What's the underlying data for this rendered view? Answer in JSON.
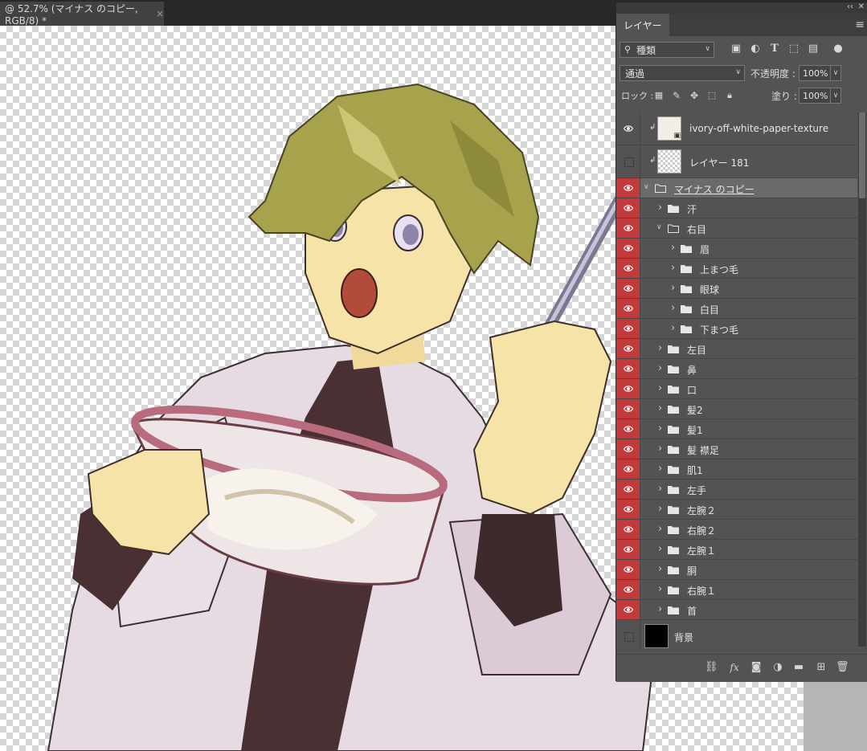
{
  "document_tab": {
    "title": "@ 52.7% (マイナス のコピー, RGB/8) *",
    "close": "×"
  },
  "panel": {
    "tab_label": "レイヤー",
    "collapse": "‹‹",
    "close": "✕",
    "menu": "≡",
    "filter": {
      "kind_label": "種類",
      "icons": [
        "image-filter-icon",
        "adjustment-filter-icon",
        "type-filter-icon",
        "shape-filter-icon",
        "smart-object-filter-icon",
        "filter-toggle-icon"
      ]
    },
    "blend_mode": "通過",
    "opacity_label": "不透明度 :",
    "opacity_value": "100%",
    "lock_label": "ロック :",
    "fill_label": "塗り :",
    "fill_value": "100%",
    "footer_icons": [
      "link-layers-icon",
      "fx-icon",
      "add-mask-icon",
      "adjustment-layer-icon",
      "new-group-icon",
      "new-layer-icon",
      "delete-layer-icon"
    ]
  },
  "layers": [
    {
      "name": "ivory-off-white-paper-texture",
      "kind": "smart",
      "visible": true,
      "red": false,
      "indent": 0,
      "clip": true
    },
    {
      "name": "レイヤー 181",
      "kind": "pixel",
      "visible": false,
      "red": false,
      "indent": 0,
      "clip": true
    },
    {
      "name": "マイナス のコピー",
      "kind": "group",
      "visible": true,
      "red": true,
      "indent": 0,
      "open": true,
      "selected": true
    },
    {
      "name": "汗",
      "kind": "group",
      "visible": true,
      "red": true,
      "indent": 1
    },
    {
      "name": "右目",
      "kind": "group",
      "visible": true,
      "red": true,
      "indent": 1,
      "open": true
    },
    {
      "name": "眉",
      "kind": "group",
      "visible": true,
      "red": true,
      "indent": 2
    },
    {
      "name": "上まつ毛",
      "kind": "group",
      "visible": true,
      "red": true,
      "indent": 2
    },
    {
      "name": "眼球",
      "kind": "group",
      "visible": true,
      "red": true,
      "indent": 2
    },
    {
      "name": "白目",
      "kind": "group",
      "visible": true,
      "red": true,
      "indent": 2
    },
    {
      "name": "下まつ毛",
      "kind": "group",
      "visible": true,
      "red": true,
      "indent": 2
    },
    {
      "name": "左目",
      "kind": "group",
      "visible": true,
      "red": true,
      "indent": 1
    },
    {
      "name": "鼻",
      "kind": "group",
      "visible": true,
      "red": true,
      "indent": 1
    },
    {
      "name": "口",
      "kind": "group",
      "visible": true,
      "red": true,
      "indent": 1
    },
    {
      "name": "髪2",
      "kind": "group",
      "visible": true,
      "red": true,
      "indent": 1
    },
    {
      "name": "髪1",
      "kind": "group",
      "visible": true,
      "red": true,
      "indent": 1
    },
    {
      "name": "髪 襟足",
      "kind": "group",
      "visible": true,
      "red": true,
      "indent": 1
    },
    {
      "name": "肌1",
      "kind": "group",
      "visible": true,
      "red": true,
      "indent": 1
    },
    {
      "name": "左手",
      "kind": "group",
      "visible": true,
      "red": true,
      "indent": 1
    },
    {
      "name": "左腕２",
      "kind": "group",
      "visible": true,
      "red": true,
      "indent": 1
    },
    {
      "name": "右腕２",
      "kind": "group",
      "visible": true,
      "red": true,
      "indent": 1
    },
    {
      "name": "左腕１",
      "kind": "group",
      "visible": true,
      "red": true,
      "indent": 1
    },
    {
      "name": "胴",
      "kind": "group",
      "visible": true,
      "red": true,
      "indent": 1
    },
    {
      "name": "右腕１",
      "kind": "group",
      "visible": true,
      "red": true,
      "indent": 1
    },
    {
      "name": "首",
      "kind": "group",
      "visible": true,
      "red": true,
      "indent": 1
    },
    {
      "name": "背景",
      "kind": "background",
      "visible": false,
      "red": false,
      "indent": 0
    }
  ]
}
